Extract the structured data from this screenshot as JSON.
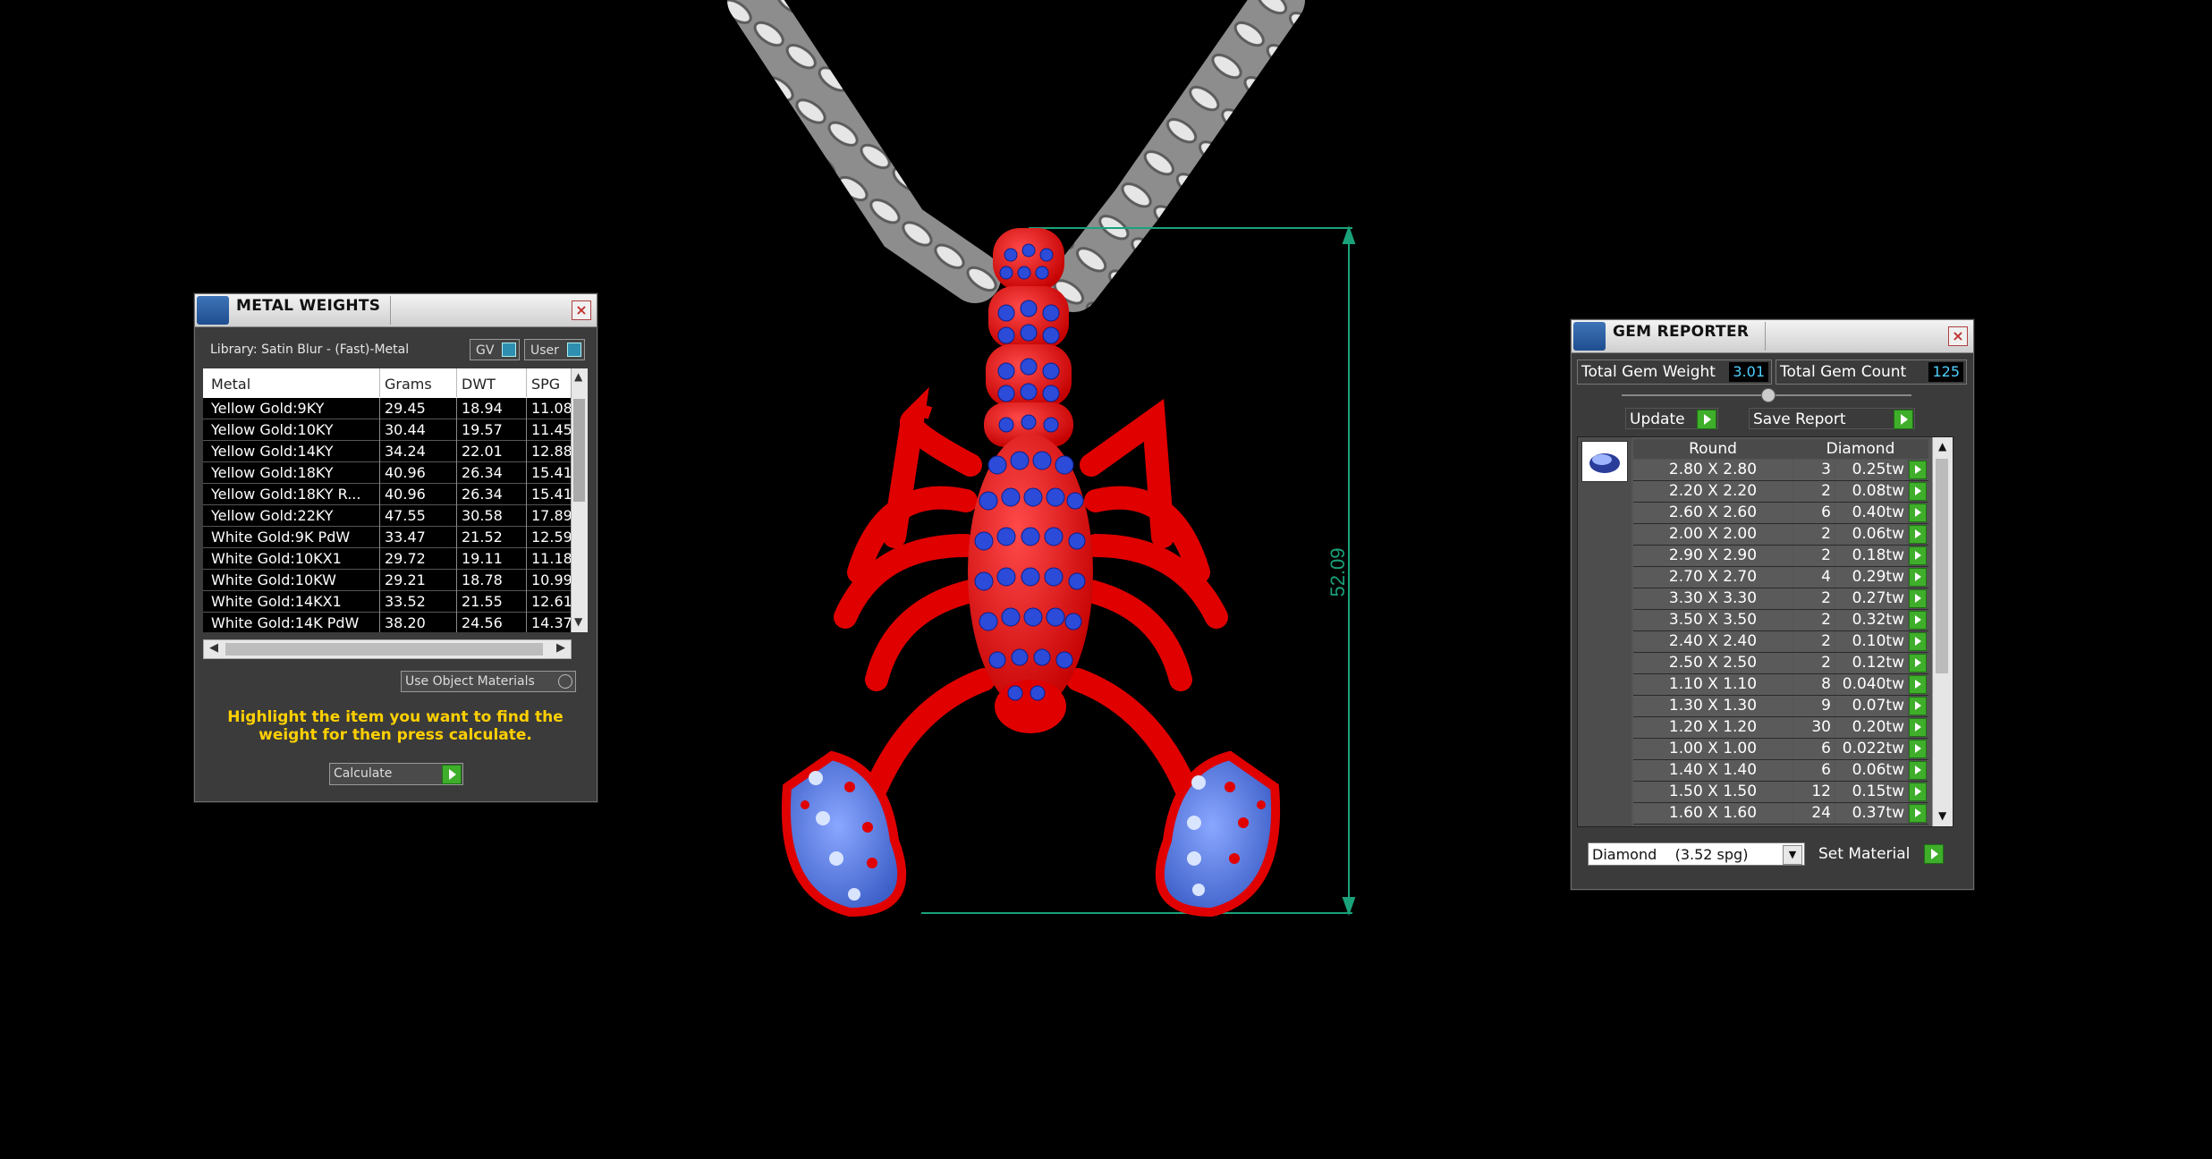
{
  "dimension": {
    "label": "52.09",
    "color": "#1aa27a"
  },
  "metal_weights": {
    "title": "METAL WEIGHTS",
    "library": "Library: Satin Blur - (Fast)-Metal",
    "gv_label": "GV",
    "user_label": "User",
    "columns": [
      "Metal",
      "Grams",
      "DWT",
      "SPG"
    ],
    "rows": [
      [
        "Yellow Gold:9KY",
        "29.45",
        "18.94",
        "11.08"
      ],
      [
        "Yellow Gold:10KY",
        "30.44",
        "19.57",
        "11.45"
      ],
      [
        "Yellow Gold:14KY",
        "34.24",
        "22.01",
        "12.88"
      ],
      [
        "Yellow Gold:18KY",
        "40.96",
        "26.34",
        "15.41"
      ],
      [
        "Yellow Gold:18KY R...",
        "40.96",
        "26.34",
        "15.41"
      ],
      [
        "Yellow Gold:22KY",
        "47.55",
        "30.58",
        "17.89"
      ],
      [
        "White Gold:9K PdW",
        "33.47",
        "21.52",
        "12.59"
      ],
      [
        "White Gold:10KX1",
        "29.72",
        "19.11",
        "11.18"
      ],
      [
        "White Gold:10KW",
        "29.21",
        "18.78",
        "10.99"
      ],
      [
        "White Gold:14KX1",
        "33.52",
        "21.55",
        "12.61"
      ],
      [
        "White Gold:14K PdW",
        "38.20",
        "24.56",
        "14.37"
      ]
    ],
    "use_object_materials": "Use Object Materials",
    "hint": "Highlight the item you want to find the weight for then press calculate.",
    "calculate": "Calculate"
  },
  "gem_reporter": {
    "title": "GEM REPORTER",
    "total_weight_label": "Total Gem Weight",
    "total_weight_value": "3.01",
    "total_count_label": "Total Gem Count",
    "total_count_value": "125",
    "update_label": "Update",
    "save_report_label": "Save Report",
    "col_shape": "Round",
    "col_material": "Diamond",
    "gems": [
      [
        "2.80 X 2.80",
        "3",
        "0.25tw"
      ],
      [
        "2.20 X 2.20",
        "2",
        "0.08tw"
      ],
      [
        "2.60 X 2.60",
        "6",
        "0.40tw"
      ],
      [
        "2.00 X 2.00",
        "2",
        "0.06tw"
      ],
      [
        "2.90 X 2.90",
        "2",
        "0.18tw"
      ],
      [
        "2.70 X 2.70",
        "4",
        "0.29tw"
      ],
      [
        "3.30 X 3.30",
        "2",
        "0.27tw"
      ],
      [
        "3.50 X 3.50",
        "2",
        "0.32tw"
      ],
      [
        "2.40 X 2.40",
        "2",
        "0.10tw"
      ],
      [
        "2.50 X 2.50",
        "2",
        "0.12tw"
      ],
      [
        "1.10 X 1.10",
        "8",
        "0.040tw"
      ],
      [
        "1.30 X 1.30",
        "9",
        "0.07tw"
      ],
      [
        "1.20 X 1.20",
        "30",
        "0.20tw"
      ],
      [
        "1.00 X 1.00",
        "6",
        "0.022tw"
      ],
      [
        "1.40 X 1.40",
        "6",
        "0.06tw"
      ],
      [
        "1.50 X 1.50",
        "12",
        "0.15tw"
      ],
      [
        "1.60 X 1.60",
        "24",
        "0.37tw"
      ]
    ],
    "material_select": "Diamond    (3.52 spg)",
    "set_material_label": "Set Material"
  }
}
